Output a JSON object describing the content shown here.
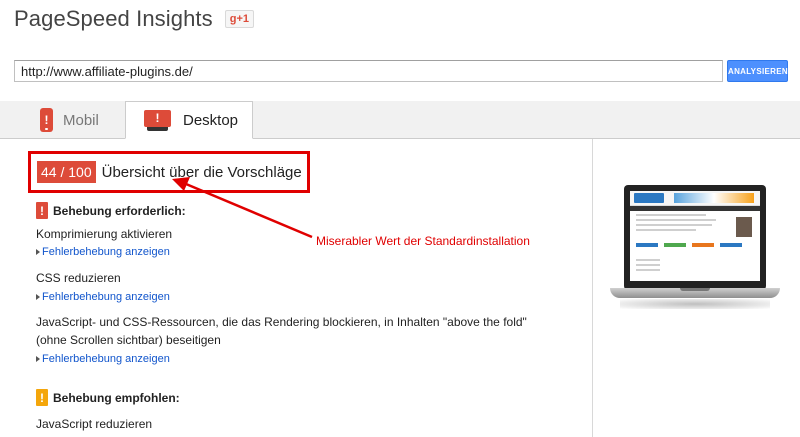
{
  "header": {
    "title": "PageSpeed Insights",
    "gplus_label": "g+1"
  },
  "url_bar": {
    "value": "http://www.affiliate-plugins.de/",
    "analyze_label": "ANALYSIEREN"
  },
  "tabs": [
    {
      "label": "Mobil",
      "active": false
    },
    {
      "label": "Desktop",
      "active": true
    }
  ],
  "summary": {
    "score": "44 / 100",
    "title": "Übersicht über die Vorschläge"
  },
  "sections": {
    "required": {
      "heading": "Behebung erforderlich:",
      "icon_text": "!",
      "rules": [
        {
          "name": "Komprimierung aktivieren",
          "link": "Fehlerbehebung anzeigen"
        },
        {
          "name": "CSS reduzieren",
          "link": "Fehlerbehebung anzeigen"
        },
        {
          "name": "JavaScript- und CSS-Ressourcen, die das Rendering blockieren, in Inhalten \"above the fold\" (ohne Scrollen sichtbar) beseitigen",
          "link": "Fehlerbehebung anzeigen"
        }
      ]
    },
    "recommended": {
      "heading": "Behebung empfohlen:",
      "icon_text": "!",
      "rules": [
        {
          "name": "JavaScript reduzieren"
        }
      ]
    }
  },
  "annotation": {
    "text": "Miserabler Wert der Standardinstallation",
    "color": "#e00000"
  },
  "colors": {
    "score_red": "#dd4b39",
    "link_blue": "#1155cc",
    "button_blue": "#4d90fe",
    "warn_orange": "#f4a60b"
  },
  "icons": {
    "mobile_tab": "phone-icon",
    "desktop_tab": "monitor-icon",
    "required": "warning-red-icon",
    "recommended": "warning-orange-icon",
    "link_arrow": "triangle-right-icon"
  }
}
